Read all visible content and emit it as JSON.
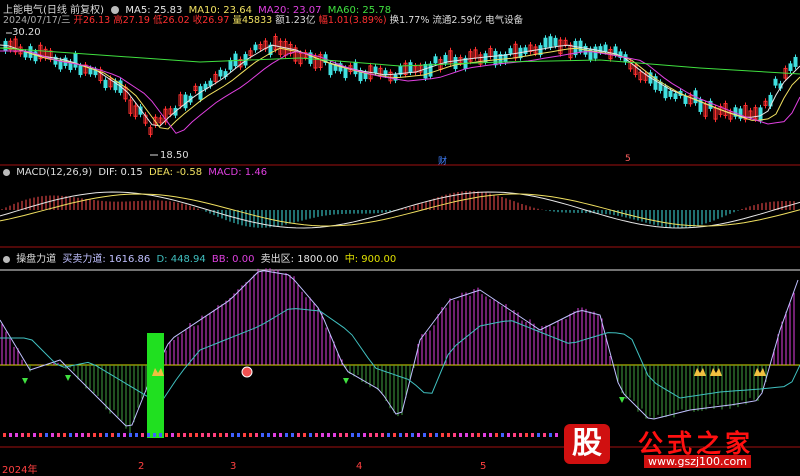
{
  "header": {
    "stock_title": "上能电气(日线 前复权)",
    "ma5_label": "MA5: 25.83",
    "ma10_label": "MA10: 23.64",
    "ma20_label": "MA20: 23.07",
    "ma60_label": "MA60: 25.78"
  },
  "quote": {
    "date": "2024/07/17/三",
    "open": "开26.13",
    "high": "高27.19",
    "low": "低26.02",
    "close": "收26.97",
    "volume": "量45833",
    "amount": "额1.23亿",
    "change": "幅1.01(3.89%)",
    "turnover": "换1.77%",
    "float_cap": "流通2.59亿",
    "industry": "电气设备"
  },
  "price_panel": {
    "high_mark": "30.20",
    "low_mark": "18.50",
    "marker_cai": "财",
    "marker_5": "5"
  },
  "macd_panel": {
    "title": "MACD(12,26,9)",
    "dif": "DIF: 0.15",
    "dea": "DEA: -0.58",
    "macd": "MACD: 1.46"
  },
  "force_panel": {
    "title": "操盘力道",
    "force": "买卖力道: 1616.86",
    "d": "D: 448.94",
    "bb": "BB: 0.00",
    "sell_zone": "卖出区: 1800.00",
    "mid": "中: 900.00"
  },
  "xaxis": {
    "year": "2024年",
    "m2": "2",
    "m3": "3",
    "m4": "4",
    "m5": "5"
  },
  "watermark": {
    "gu": "股",
    "brand": "公式之家",
    "url": "www.gszj100.com"
  },
  "colors": {
    "up": "#ff3030",
    "down": "#40e0e0",
    "ma5": "#e6e6e6",
    "ma10": "#f0e060",
    "ma20": "#e040e0",
    "ma60": "#40e040",
    "divider": "#a01010"
  }
}
